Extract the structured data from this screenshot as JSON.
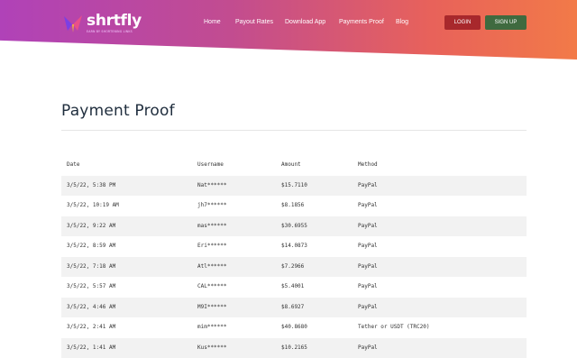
{
  "brand": {
    "name": "shrtfly",
    "tagline": "EARN BY SHORTENING LINKS"
  },
  "nav": {
    "items": [
      {
        "label": "Home"
      },
      {
        "label": "Payout Rates"
      },
      {
        "label": "Download App"
      },
      {
        "label": "Payments Proof"
      },
      {
        "label": "Blog"
      }
    ],
    "login_label": "LOGIN",
    "signup_label": "SIGN UP"
  },
  "colors": {
    "header_gradient_start": "#b042b8",
    "header_gradient_end": "#f27a48",
    "login_button": "#a8282c",
    "signup_button": "#3f6a3f"
  },
  "main": {
    "title": "Payment Proof",
    "table": {
      "headers": [
        "Date",
        "Username",
        "Amount",
        "Method"
      ],
      "rows": [
        [
          "3/5/22, 5:38 PM",
          "Nat******",
          "$15.7110",
          "PayPal"
        ],
        [
          "3/5/22, 10:19 AM",
          "jh7******",
          "$8.1856",
          "PayPal"
        ],
        [
          "3/5/22, 9:22 AM",
          "mas******",
          "$30.6955",
          "PayPal"
        ],
        [
          "3/5/22, 8:59 AM",
          "Eri******",
          "$14.0873",
          "PayPal"
        ],
        [
          "3/5/22, 7:18 AM",
          "Atl******",
          "$7.2966",
          "PayPal"
        ],
        [
          "3/5/22, 5:57 AM",
          "CAL******",
          "$5.4001",
          "PayPal"
        ],
        [
          "3/5/22, 4:46 AM",
          "M9I******",
          "$8.6927",
          "PayPal"
        ],
        [
          "3/5/22, 2:41 AM",
          "mim******",
          "$40.8680",
          "Tether or USDT (TRC20)"
        ],
        [
          "3/5/22, 1:41 AM",
          "Kus******",
          "$10.2165",
          "PayPal"
        ]
      ]
    }
  }
}
